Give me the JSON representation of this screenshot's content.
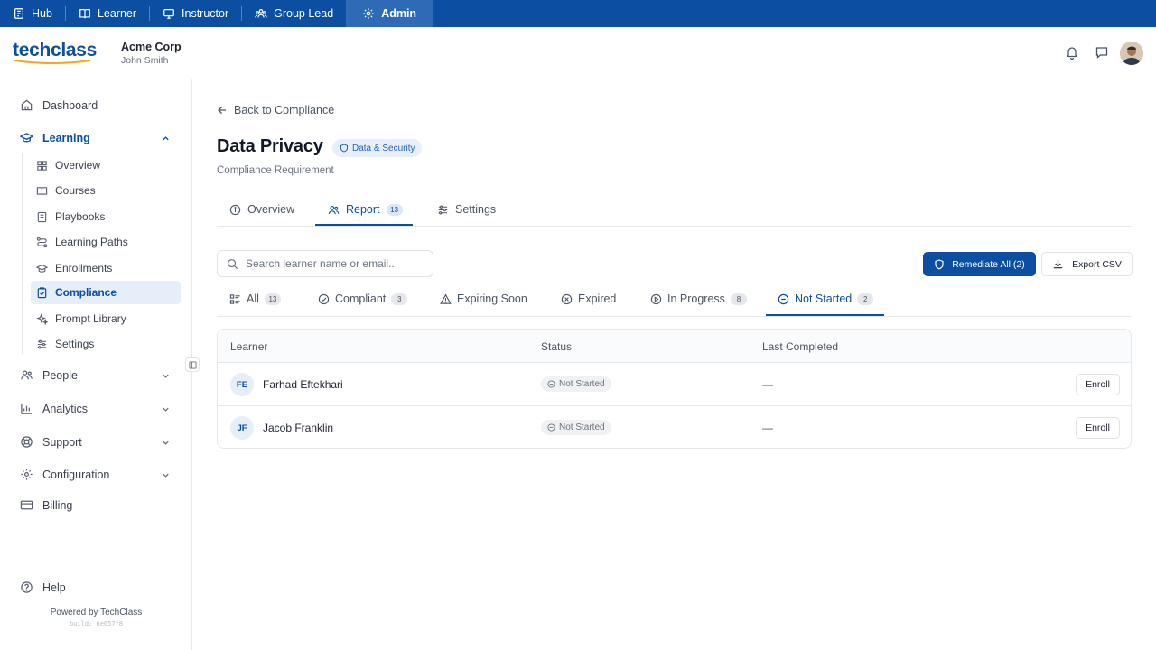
{
  "topbar": {
    "roles": [
      {
        "label": "Hub",
        "icon": "hub-icon"
      },
      {
        "label": "Learner",
        "icon": "book-icon"
      },
      {
        "label": "Instructor",
        "icon": "monitor-icon"
      },
      {
        "label": "Group Lead",
        "icon": "group-icon"
      },
      {
        "label": "Admin",
        "icon": "gear-icon",
        "active": true
      }
    ],
    "bg_color": "#0b4ea2",
    "active_color": "#2e6ab5"
  },
  "header": {
    "logo": "techclass",
    "org_name": "Acme Corp",
    "user_name": "John Smith"
  },
  "sidebar": {
    "items": [
      {
        "label": "Dashboard",
        "icon": "home-icon"
      },
      {
        "label": "Learning",
        "icon": "graduation-cap-icon",
        "expanded": true
      },
      {
        "label": "People",
        "icon": "people-icon"
      },
      {
        "label": "Analytics",
        "icon": "bar-chart-icon"
      },
      {
        "label": "Support",
        "icon": "lifebuoy-icon"
      },
      {
        "label": "Configuration",
        "icon": "gear-icon"
      },
      {
        "label": "Billing",
        "icon": "credit-card-icon"
      }
    ],
    "learning_sub": [
      {
        "label": "Overview",
        "icon": "grid-icon"
      },
      {
        "label": "Courses",
        "icon": "book-open-icon"
      },
      {
        "label": "Playbooks",
        "icon": "notebook-icon"
      },
      {
        "label": "Learning Paths",
        "icon": "route-icon"
      },
      {
        "label": "Enrollments",
        "icon": "graduation-cap-icon"
      },
      {
        "label": "Compliance",
        "icon": "clipboard-check-icon",
        "active": true
      },
      {
        "label": "Prompt Library",
        "icon": "sparkles-icon"
      },
      {
        "label": "Settings",
        "icon": "sliders-icon"
      }
    ],
    "help": "Help",
    "powered_by": "Powered by TechClass",
    "build": "build: 6e057f8"
  },
  "main": {
    "back_label": "Back to Compliance",
    "title": "Data Privacy",
    "badge": "Data & Security",
    "subtitle": "Compliance Requirement",
    "tabs": [
      {
        "label": "Overview",
        "icon": "info-icon"
      },
      {
        "label": "Report",
        "icon": "users-icon",
        "count": "13",
        "active": true
      },
      {
        "label": "Settings",
        "icon": "sliders-icon"
      }
    ],
    "search_placeholder": "Search learner name or email...",
    "remediate_label": "Remediate All (2)",
    "export_label": "Export CSV",
    "filters": [
      {
        "label": "All",
        "icon": "list-icon",
        "count": "13"
      },
      {
        "label": "Compliant",
        "icon": "check-circle-icon",
        "count": "3"
      },
      {
        "label": "Expiring Soon",
        "icon": "warning-icon"
      },
      {
        "label": "Expired",
        "icon": "x-circle-icon"
      },
      {
        "label": "In Progress",
        "icon": "play-circle-icon",
        "count": "8"
      },
      {
        "label": "Not Started",
        "icon": "minus-circle-icon",
        "count": "2",
        "active": true
      }
    ],
    "table": {
      "columns": [
        "Learner",
        "Status",
        "Last Completed"
      ],
      "rows": [
        {
          "initials": "FE",
          "name": "Farhad Eftekhari",
          "status": "Not Started",
          "last_completed": "—",
          "action": "Enroll"
        },
        {
          "initials": "JF",
          "name": "Jacob Franklin",
          "status": "Not Started",
          "last_completed": "—",
          "action": "Enroll"
        }
      ]
    }
  }
}
